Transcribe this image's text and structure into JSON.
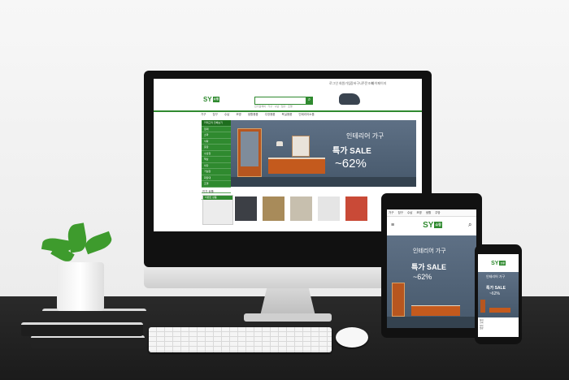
{
  "monitor": {
    "topbar_links": [
      "로그인",
      "회원가입",
      "장바구니",
      "주문조회",
      "마이페이지",
      "고객센터"
    ],
    "logo": {
      "text": "SY",
      "badge": "쇼핑"
    },
    "search_tags": [
      "인기검색어",
      "가구",
      "수납",
      "침구",
      "조명",
      "주방",
      "욕실"
    ],
    "menu": [
      "카테고리 전체보기",
      "가구",
      "침구",
      "수납",
      "조명",
      "생활용품",
      "주방용품",
      "욕실용품",
      "인테리어소품"
    ],
    "sidebar": {
      "title": "카테고리 전체보기",
      "items": [
        "침대",
        "소파",
        "식탁",
        "옷장",
        "수납장",
        "책상",
        "의자",
        "거실장",
        "화장대",
        "조명",
        "커튼",
        "러그"
      ]
    },
    "banner": {
      "line1": "인테리어 가구",
      "line2": "특가 SALE",
      "line3": "~62%"
    },
    "section_title": "인기 상품",
    "left_box_title": "이벤트 상품"
  },
  "tablet": {
    "menu": [
      "가구",
      "침구",
      "수납",
      "조명",
      "생활",
      "주방"
    ],
    "logo": {
      "text": "SY",
      "badge": "쇼핑"
    },
    "banner": {
      "line1": "인테리어 가구",
      "line2": "특가 SALE",
      "line3": "~62%"
    }
  },
  "phone": {
    "logo": {
      "text": "SY",
      "badge": "쇼핑"
    },
    "banner": {
      "line1": "인테리어 가구",
      "line2": "특가 SALE",
      "line3": "~62%"
    }
  },
  "colors": {
    "brand_green": "#2f8a2f",
    "banner_blue": "#5e7085",
    "furniture_orange": "#c45a1d"
  }
}
